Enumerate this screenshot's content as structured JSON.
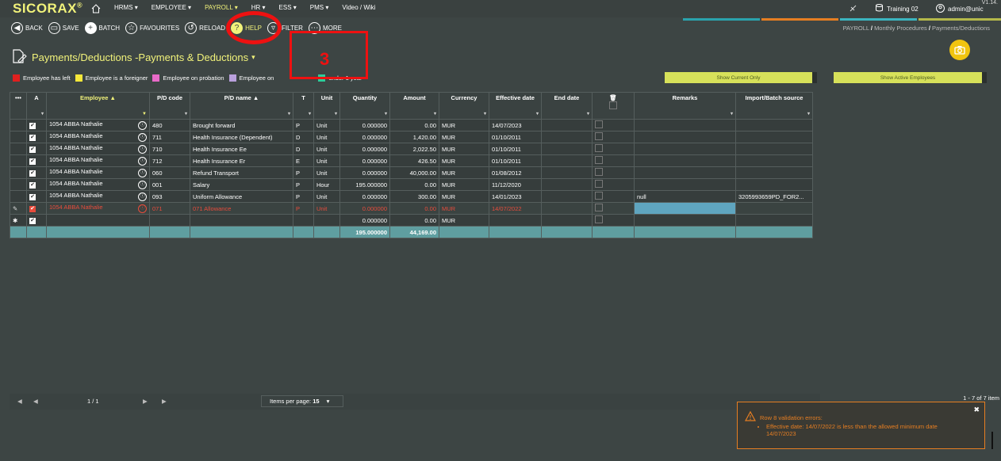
{
  "app": {
    "logo": "SICORAX",
    "registered": "®",
    "version": "V1.14.",
    "home_icon": "home-icon"
  },
  "nav": [
    "HRMS ▾",
    "EMPLOYEE ▾",
    "PAYROLL ▾",
    "HR ▾",
    "ESS ▾",
    "PMS ▾",
    "Video / Wiki"
  ],
  "topright": {
    "training": "Training 02",
    "user": "admin@unic"
  },
  "toolbar": {
    "back": "BACK",
    "save": "SAVE",
    "batch": "BATCH",
    "favourites": "FAVOURITES",
    "reload": "RELOAD",
    "help": "HELP",
    "filter": "FILTER",
    "more": "MORE"
  },
  "breadcrumb": {
    "a": "PAYROLL",
    "sep": "/",
    "b": "Monthly Procedures",
    "c": "Payments/Deductions"
  },
  "page_title": "Payments/Deductions -Payments & Deductions",
  "legend": [
    {
      "color": "#e0201f",
      "label": "Employee has left"
    },
    {
      "color": "#f5e83a",
      "label": "Employee is a foreigner"
    },
    {
      "color": "#e86ac8",
      "label": "Employee on probation"
    },
    {
      "color": "#b9a0dc",
      "label": "Employee on"
    },
    {
      "color": "#2ecc9a",
      "label": "under 1 year"
    }
  ],
  "toggles": {
    "current": "Show Current Only",
    "active": "Show Active Employees"
  },
  "columns": [
    "•••",
    "A",
    "Employee ▲",
    "P/D code",
    "P/D name ▲",
    "T",
    "Unit",
    "Quantity",
    "Amount",
    "Currency",
    "Effective date",
    "End date",
    "🗑",
    "Remarks",
    "Import/Batch source"
  ],
  "rows": [
    {
      "emp": "1054 ABBA Nathalie",
      "code": "480",
      "name": "Brought forward",
      "t": "P",
      "unit": "Unit",
      "qty": "0.000000",
      "amt": "0.00",
      "cur": "MUR",
      "eff": "14/07/2023",
      "remarks": "",
      "src": ""
    },
    {
      "emp": "1054 ABBA Nathalie",
      "code": "711",
      "name": "Health Insurance (Dependent)",
      "t": "D",
      "unit": "Unit",
      "qty": "0.000000",
      "amt": "1,420.00",
      "cur": "MUR",
      "eff": "01/10/2011",
      "remarks": "",
      "src": ""
    },
    {
      "emp": "1054 ABBA Nathalie",
      "code": "710",
      "name": "Health Insurance Ee",
      "t": "D",
      "unit": "Unit",
      "qty": "0.000000",
      "amt": "2,022.50",
      "cur": "MUR",
      "eff": "01/10/2011",
      "remarks": "",
      "src": ""
    },
    {
      "emp": "1054 ABBA Nathalie",
      "code": "712",
      "name": "Health Insurance Er",
      "t": "E",
      "unit": "Unit",
      "qty": "0.000000",
      "amt": "426.50",
      "cur": "MUR",
      "eff": "01/10/2011",
      "remarks": "",
      "src": ""
    },
    {
      "emp": "1054 ABBA Nathalie",
      "code": "060",
      "name": "Refund Transport",
      "t": "P",
      "unit": "Unit",
      "qty": "0.000000",
      "amt": "40,000.00",
      "cur": "MUR",
      "eff": "01/08/2012",
      "remarks": "",
      "src": ""
    },
    {
      "emp": "1054 ABBA Nathalie",
      "code": "001",
      "name": "Salary",
      "t": "P",
      "unit": "Hour",
      "qty": "195.000000",
      "amt": "0.00",
      "cur": "MUR",
      "eff": "11/12/2020",
      "remarks": "",
      "src": ""
    },
    {
      "emp": "1054 ABBA Nathalie",
      "code": "093",
      "name": "Uniform Allowance",
      "t": "P",
      "unit": "Unit",
      "qty": "0.000000",
      "amt": "300.00",
      "cur": "MUR",
      "eff": "14/01/2023",
      "remarks": "null",
      "src": "3205993659PD_FOR2..."
    }
  ],
  "error_row": {
    "emp": "1054 ABBA Nathalie",
    "code": "071",
    "name": "071 Allowance",
    "t": "P",
    "unit": "Unit",
    "qty": "0.000000",
    "amt": "0.00",
    "cur": "MUR",
    "eff": "14/07/2022"
  },
  "new_row": {
    "qty": "0.000000",
    "amt": "0.00",
    "cur": "MUR"
  },
  "totals": {
    "qty": "195.000000",
    "amt": "44,169.00"
  },
  "pager": {
    "page": "1 / 1",
    "ipp_label": "Items per page:",
    "ipp": "15",
    "count": "1 - 7 of 7 item"
  },
  "notification": {
    "title": "Row 8 validation errors:",
    "msg": "Effective date: 14/07/2022 is less than the allowed minimum date",
    "msg2": "14/07/2023"
  },
  "annotation": {
    "number": "3"
  }
}
